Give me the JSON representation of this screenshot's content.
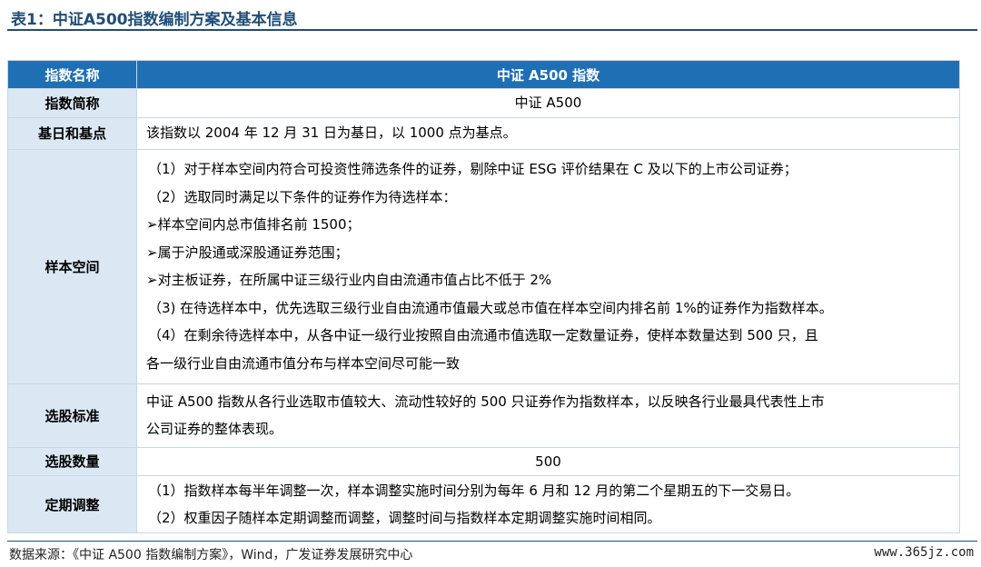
{
  "title": "表1：中证A500指数编制方案及基本信息",
  "table": {
    "header": {
      "label": "指数名称",
      "value": "中证 A500 指数"
    },
    "rows": [
      {
        "label": "指数简称",
        "lines": [
          "中证 A500"
        ]
      },
      {
        "label": "基日和基点",
        "lines": [
          "该指数以 2004 年 12 月 31 日为基日，以 1000 点为基点。"
        ]
      },
      {
        "label": "样本空间",
        "lines": [
          "（1）对于样本空间内符合可投资性筛选条件的证券，剔除中证 ESG 评价结果在 C 及以下的上市公司证券；",
          "（2）选取同时满足以下条件的证券作为待选样本：",
          "➢样本空间内总市值排名前 1500；",
          "➢属于沪股通或深股通证券范围；",
          "➢对主板证券，在所属中证三级行业内自由流通市值占比不低于 2%",
          "（3) 在待选样本中，优先选取三级行业自由流通市值最大或总市值在样本空间内排名前 1%的证券作为指数样本。",
          "（4）在剩余待选样本中，从各中证一级行业按照自由流通市值选取一定数量证券，使样本数量达到 500 只，且",
          "各一级行业自由流通市值分布与样本空间尽可能一致"
        ]
      },
      {
        "label": "选股标准",
        "lines": [
          "中证 A500 指数从各行业选取市值较大、流动性较好的 500 只证券作为指数样本，以反映各行业最具代表性上市",
          "公司证券的整体表现。"
        ]
      },
      {
        "label": "选股数量",
        "lines": [
          "500"
        ]
      },
      {
        "label": "定期调整",
        "lines": [
          "（1）指数样本每半年调整一次，样本调整实施时间分别为每年 6 月和 12 月的第二个星期五的下一交易日。",
          "（2）权重因子随样本定期调整而调整，调整时间与指数样本定期调整实施时间相同。"
        ]
      }
    ]
  },
  "footer": {
    "source": "数据来源：《中证 A500 指数编制方案》，Wind，广发证券发展研究中心",
    "watermark": "www.365jz.com"
  }
}
